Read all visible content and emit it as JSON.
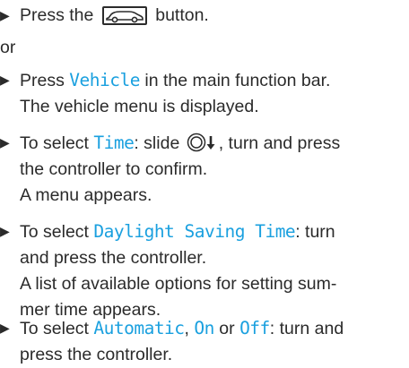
{
  "steps": [
    {
      "id": "press-vehicle-button",
      "parts": {
        "a": "Press the",
        "b": "button."
      },
      "icon": "car-icon"
    },
    {
      "id": "or",
      "text": "or"
    },
    {
      "id": "press-vehicle",
      "line1": {
        "a": "Press ",
        "cmd": "Vehicle",
        "b": " in the main function bar."
      },
      "line2": "The vehicle menu is displayed."
    },
    {
      "id": "select-time",
      "line1": {
        "a": "To select ",
        "cmd": "Time",
        "b": ": slide",
        "c": ", turn and press"
      },
      "line2": "the controller to confirm.",
      "line3": "A menu appears.",
      "icon": "controller-slide-down-icon"
    },
    {
      "id": "select-daylight-saving",
      "line1": {
        "a": "To select ",
        "cmd": "Daylight Saving Time",
        "b": ": turn"
      },
      "line2": "and press the controller.",
      "line3": "A list of available options for setting sum-",
      "line4": "mer time appears."
    },
    {
      "id": "select-automatic-on-off",
      "line1": {
        "a": "To select ",
        "cmd1": "Automatic",
        "sep1": ", ",
        "cmd2": "On",
        "sep2": " or ",
        "cmd3": "Off",
        "b": ": turn and"
      },
      "line2": "press the controller."
    }
  ],
  "colors": {
    "command": "#1aa0df",
    "text": "#2b2b2b"
  }
}
